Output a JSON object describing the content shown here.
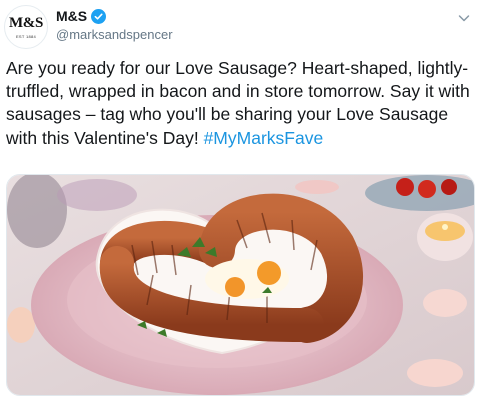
{
  "account": {
    "logo_text": "M&S",
    "logo_subtext": "EST 1884",
    "display_name": "M&S",
    "handle": "@marksandspencer"
  },
  "tweet": {
    "text": "Are you ready for our Love Sausage? Heart-shaped, lightly-truffled, wrapped in bacon and in store tomorrow. Say it with sausages – tag who you'll be sharing your Love Sausage with this Valentine's Day!",
    "hashtag": "#MyMarksFave"
  },
  "icons": {
    "verified": "verified-badge-icon",
    "menu": "chevron-down-icon"
  },
  "colors": {
    "accent": "#1da1f2",
    "hashtag": "#1b95e0",
    "text": "#14171a",
    "muted": "#657786"
  },
  "media": {
    "type": "photo"
  }
}
